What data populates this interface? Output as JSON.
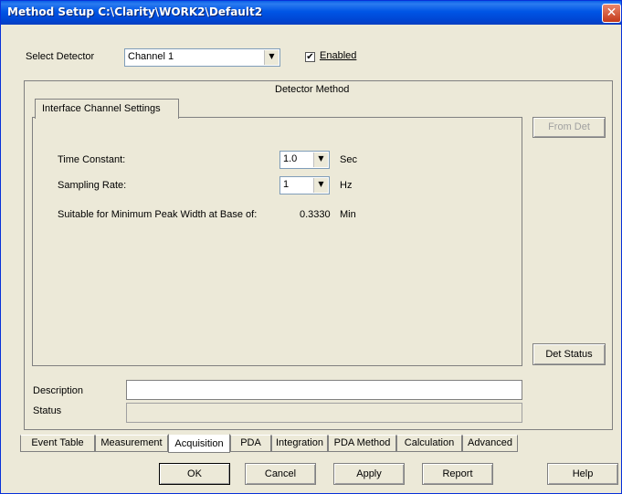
{
  "window": {
    "title": "Method Setup C:\\Clarity\\WORK2\\Default2",
    "close": "✕"
  },
  "detector": {
    "label": "Select Detector",
    "selected": "Channel 1",
    "enabled_label": "Enabled",
    "enabled": true
  },
  "panel": {
    "title": "Detector Method",
    "tab": "Interface Channel Settings"
  },
  "settings": {
    "time_constant_label": "Time Constant:",
    "time_constant_value": "1.0",
    "time_constant_unit": "Sec",
    "sampling_rate_label": "Sampling Rate:",
    "sampling_rate_value": "1",
    "sampling_rate_unit": "Hz",
    "min_peak_label": "Suitable for Minimum Peak Width at Base of:",
    "min_peak_value": "0.3330",
    "min_peak_unit": "Min"
  },
  "side_buttons": {
    "from_det": "From Det",
    "det_status": "Det Status"
  },
  "description": {
    "label": "Description",
    "value": ""
  },
  "status": {
    "label": "Status",
    "value": ""
  },
  "tabs": [
    "Event Table",
    "Measurement",
    "Acquisition",
    "PDA",
    "Integration",
    "PDA Method",
    "Calculation",
    "Advanced"
  ],
  "active_tab": "Acquisition",
  "buttons": {
    "ok": "OK",
    "cancel": "Cancel",
    "apply": "Apply",
    "report": "Report",
    "help": "Help"
  }
}
